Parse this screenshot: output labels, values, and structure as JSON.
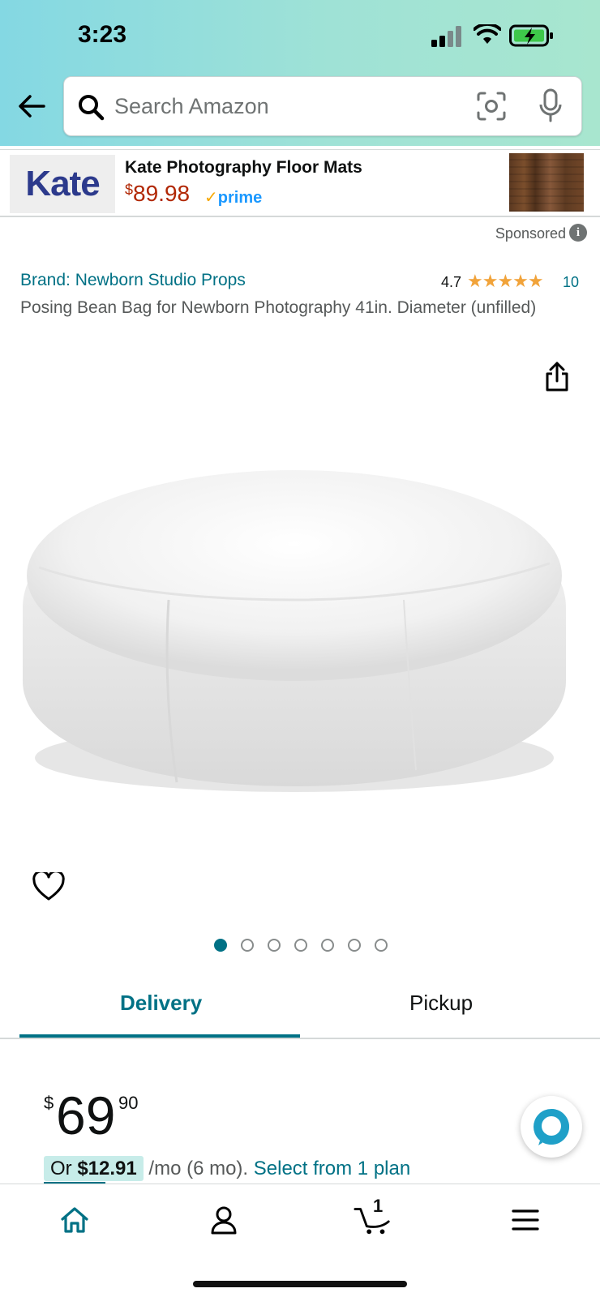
{
  "status_bar": {
    "time": "3:23"
  },
  "search": {
    "placeholder": "Search Amazon"
  },
  "banner": {
    "logo_text": "Kate",
    "title": "Kate Photography Floor Mats",
    "price_currency": "$",
    "price": "89.98",
    "prime_check": "✓",
    "prime_label": "prime",
    "sponsored_label": "Sponsored",
    "info_glyph": "i"
  },
  "product": {
    "brand": "Brand: Newborn Studio Props",
    "rating": "4.7",
    "stars_display": "★★★★★",
    "review_count": "10",
    "title": "Posing Bean Bag for Newborn Photography 41in. Diameter (unfilled)",
    "image_count": 7,
    "active_image_index": 0
  },
  "tabs": {
    "delivery": "Delivery",
    "pickup": "Pickup",
    "active": "delivery"
  },
  "price": {
    "currency": "$",
    "whole": "69",
    "fraction": "90"
  },
  "finance": {
    "prefix": "Or ",
    "monthly": "$12.91",
    "suffix": " /mo (6 mo). ",
    "link": "Select from 1 plan"
  },
  "bottom_nav": {
    "items": [
      "home-icon",
      "account-icon",
      "cart-icon",
      "menu-icon"
    ],
    "cart_count": "1"
  },
  "colors": {
    "link": "#007185",
    "price_red": "#b12704",
    "star": "#f1a33a",
    "header_gradient_start": "#84d8e3",
    "header_gradient_end": "#a8e6cf"
  }
}
